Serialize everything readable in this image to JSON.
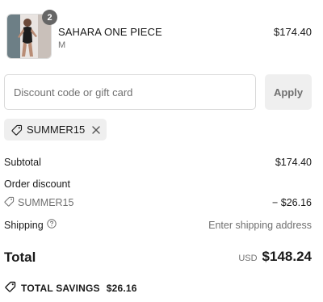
{
  "line_item": {
    "quantity": "2",
    "name": "SAHARA ONE PIECE",
    "variant": "M",
    "price": "$174.40",
    "thumbnail_icon": "product-photo"
  },
  "discount": {
    "placeholder": "Discount code or gift card",
    "value": "",
    "apply_label": "Apply",
    "applied_code": "SUMMER15"
  },
  "summary": {
    "subtotal_label": "Subtotal",
    "subtotal_value": "$174.40",
    "order_discount_label": "Order discount",
    "discount_code": "SUMMER15",
    "discount_value": "− $26.16",
    "shipping_label": "Shipping",
    "shipping_value": "Enter shipping address"
  },
  "total": {
    "label": "Total",
    "currency": "USD",
    "amount": "$148.24"
  },
  "savings": {
    "label": "TOTAL SAVINGS",
    "amount": "$26.16"
  },
  "colors": {
    "text": "#1a1a1a",
    "muted": "#707070",
    "badge": "#666666",
    "chip_bg": "#efefef",
    "border": "#d9d9d9"
  }
}
